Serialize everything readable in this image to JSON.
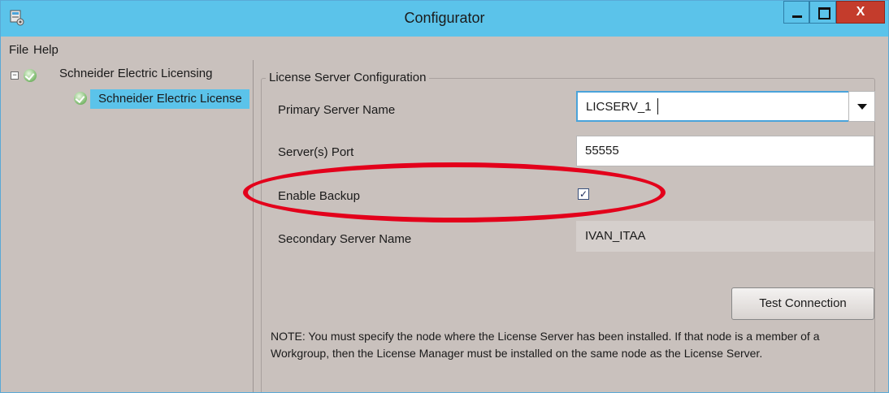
{
  "window": {
    "title": "Configurator",
    "close_glyph": "X"
  },
  "menu": {
    "file_label": "File",
    "help_label": "Help"
  },
  "tree": {
    "root_label": "Schneider Electric Licensing",
    "root_expander": "−",
    "child_label": "Schneider Electric License"
  },
  "group": {
    "title": "License Server Configuration",
    "primary_server_label": "Primary Server Name",
    "primary_server_value": "LICSERV_1",
    "port_label": "Server(s) Port",
    "port_value": "55555",
    "enable_backup_label": "Enable Backup",
    "enable_backup_checked_glyph": "✓",
    "secondary_server_label": "Secondary Server Name",
    "secondary_server_value": "IVAN_ITAA",
    "test_connection_label": "Test Connection",
    "note": "NOTE: You must specify the node where the License Server has been installed. If that node is a member of a Workgroup, then the License Manager must be installed on the same node as the License Server."
  },
  "colors": {
    "titlebar": "#5bc3ea",
    "background": "#c9c1bd",
    "selection": "#5bc3ea",
    "annotation": "#e3001b"
  },
  "icons": {
    "app": "configurator-icon",
    "tree_status": "green-check-icon",
    "dropdown": "chevron-down-icon"
  }
}
